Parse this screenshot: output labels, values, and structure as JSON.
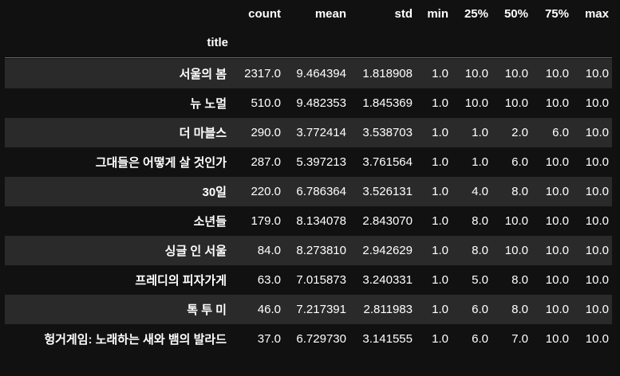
{
  "table": {
    "columns": [
      "count",
      "mean",
      "std",
      "min",
      "25%",
      "50%",
      "75%",
      "max"
    ],
    "index_name": "title",
    "rows": [
      {
        "title": "서울의 봄",
        "values": [
          "2317.0",
          "9.464394",
          "1.818908",
          "1.0",
          "10.0",
          "10.0",
          "10.0",
          "10.0"
        ]
      },
      {
        "title": "뉴 노멀",
        "values": [
          "510.0",
          "9.482353",
          "1.845369",
          "1.0",
          "10.0",
          "10.0",
          "10.0",
          "10.0"
        ]
      },
      {
        "title": "더 마블스",
        "values": [
          "290.0",
          "3.772414",
          "3.538703",
          "1.0",
          "1.0",
          "2.0",
          "6.0",
          "10.0"
        ]
      },
      {
        "title": "그대들은 어떻게 살 것인가",
        "values": [
          "287.0",
          "5.397213",
          "3.761564",
          "1.0",
          "1.0",
          "6.0",
          "10.0",
          "10.0"
        ]
      },
      {
        "title": "30일",
        "values": [
          "220.0",
          "6.786364",
          "3.526131",
          "1.0",
          "4.0",
          "8.0",
          "10.0",
          "10.0"
        ]
      },
      {
        "title": "소년들",
        "values": [
          "179.0",
          "8.134078",
          "2.843070",
          "1.0",
          "8.0",
          "10.0",
          "10.0",
          "10.0"
        ]
      },
      {
        "title": "싱글 인 서울",
        "values": [
          "84.0",
          "8.273810",
          "2.942629",
          "1.0",
          "8.0",
          "10.0",
          "10.0",
          "10.0"
        ]
      },
      {
        "title": "프레디의 피자가게",
        "values": [
          "63.0",
          "7.015873",
          "3.240331",
          "1.0",
          "5.0",
          "8.0",
          "10.0",
          "10.0"
        ]
      },
      {
        "title": "톡 투 미",
        "values": [
          "46.0",
          "7.217391",
          "2.811983",
          "1.0",
          "6.0",
          "8.0",
          "10.0",
          "10.0"
        ]
      },
      {
        "title": "헝거게임: 노래하는 새와 뱀의 발라드",
        "values": [
          "37.0",
          "6.729730",
          "3.141555",
          "1.0",
          "6.0",
          "7.0",
          "10.0",
          "10.0"
        ]
      }
    ]
  },
  "colors": {
    "background": "#111111",
    "stripe": "#2a2a2a",
    "text": "#ffffff",
    "rule": "#6a6a6a"
  }
}
